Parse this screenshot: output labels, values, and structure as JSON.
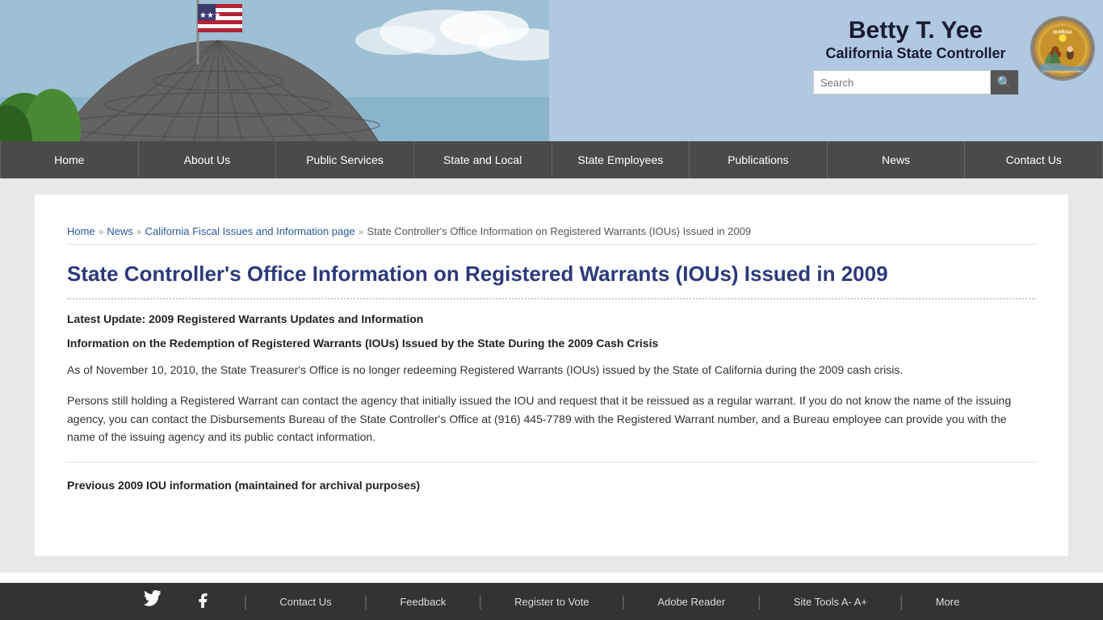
{
  "header": {
    "name": "Betty T. Yee",
    "subtitle": "California State Controller",
    "search_placeholder": "Search",
    "search_label": "Search"
  },
  "nav": {
    "items": [
      {
        "label": "Home",
        "active": false
      },
      {
        "label": "About Us",
        "active": false
      },
      {
        "label": "Public Services",
        "active": false
      },
      {
        "label": "State and Local",
        "active": false
      },
      {
        "label": "State Employees",
        "active": false
      },
      {
        "label": "Publications",
        "active": false
      },
      {
        "label": "News",
        "active": false
      },
      {
        "label": "Contact Us",
        "active": false
      }
    ]
  },
  "breadcrumb": {
    "home": "Home",
    "news": "News",
    "fiscal": "California Fiscal Issues and Information page",
    "current": "State Controller's Office Information on Registered Warrants (IOUs) Issued in 2009"
  },
  "page": {
    "title": "State Controller's Office Information on Registered Warrants (IOUs) Issued in 2009",
    "section1_heading": "Latest Update: 2009 Registered Warrants Updates and Information",
    "section2_heading": "Information on the Redemption of Registered Warrants (IOUs) Issued by the State During the 2009 Cash Crisis",
    "para1": "As of November 10, 2010, the State Treasurer's Office is no longer redeeming Registered Warrants (IOUs) issued by the State of California during the 2009 cash crisis.",
    "para2": "Persons still holding a Registered Warrant can contact the agency that initially issued the IOU and request that it be reissued as a regular warrant. If you do not know the name of the issuing agency, you can contact the Disbursements Bureau of the State Controller's Office at (916) 445-7789 with the Registered Warrant number, and a Bureau employee can provide you with the name of the issuing agency and its public contact information.",
    "previous_section": "Previous 2009 IOU information (maintained for archival purposes)"
  },
  "footer": {
    "items": [
      {
        "label": "Contact Us",
        "icon": ""
      },
      {
        "label": "Feedback",
        "icon": ""
      },
      {
        "label": "Register to Vote",
        "icon": ""
      },
      {
        "label": "Adobe Reader",
        "icon": ""
      },
      {
        "label": "Site Tools A- A+",
        "icon": ""
      },
      {
        "label": "More",
        "icon": ""
      }
    ],
    "twitter_label": "Twitter",
    "facebook_label": "Facebook"
  }
}
